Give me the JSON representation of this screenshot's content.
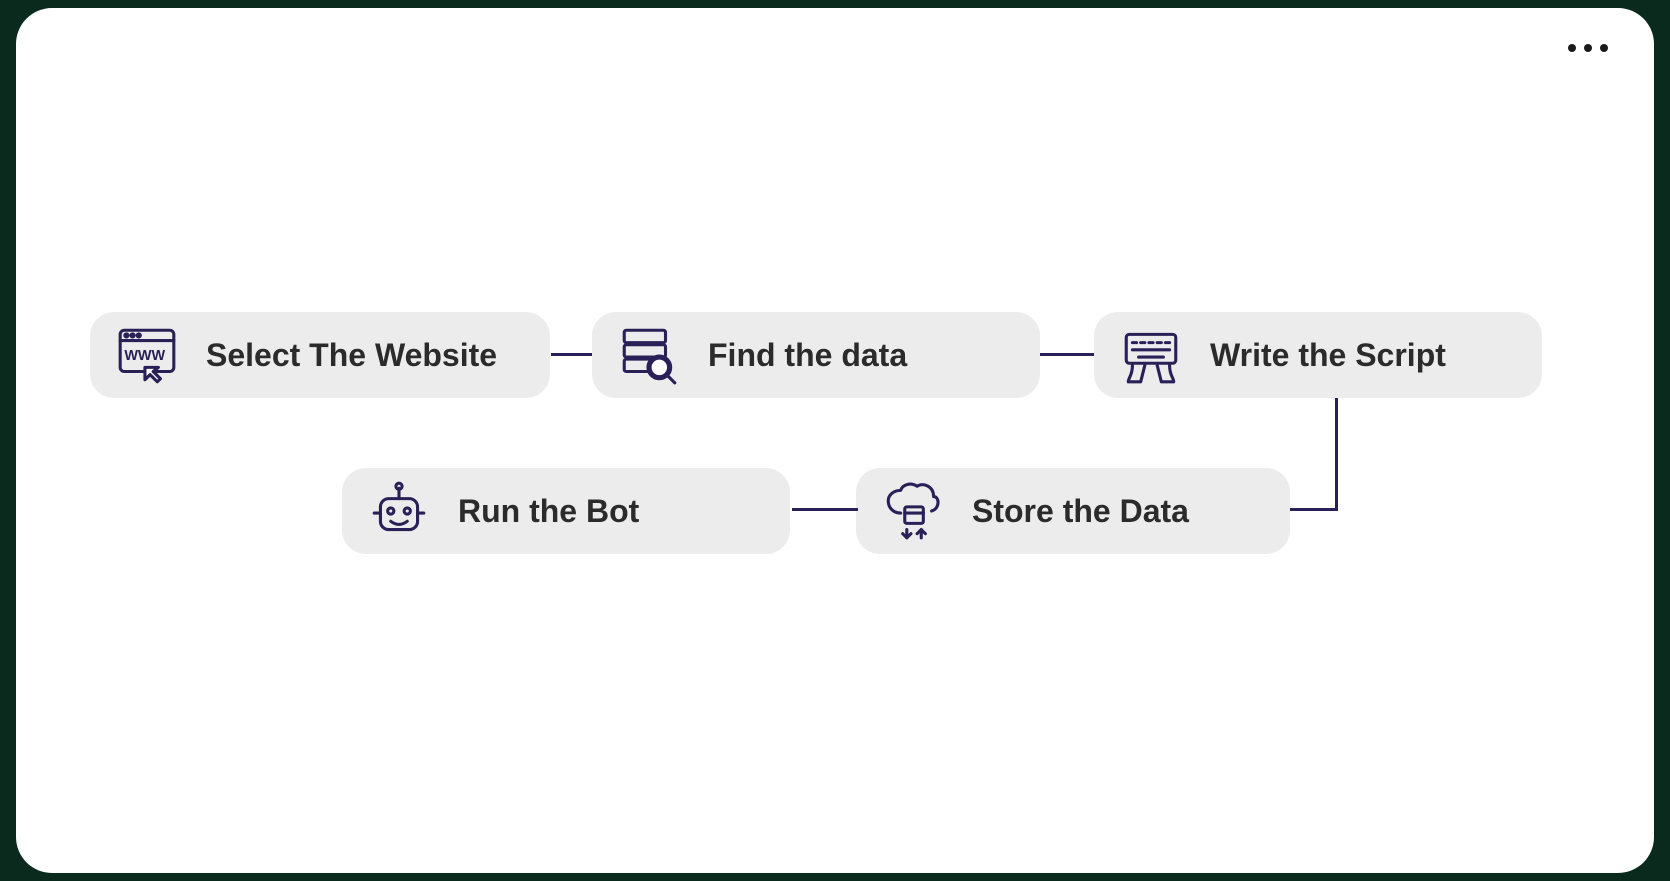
{
  "diagram": {
    "steps": [
      {
        "id": "select-website",
        "label": "Select The Website",
        "icon": "browser-www-icon"
      },
      {
        "id": "find-data",
        "label": "Find the data",
        "icon": "database-search-icon"
      },
      {
        "id": "write-script",
        "label": "Write the Script",
        "icon": "keyboard-hands-icon"
      },
      {
        "id": "store-data",
        "label": "Store the Data",
        "icon": "cloud-sync-icon"
      },
      {
        "id": "run-bot",
        "label": "Run the Bot",
        "icon": "robot-icon"
      }
    ],
    "colors": {
      "iconStroke": "#2a2058",
      "nodeBg": "#ececec",
      "text": "#2b2b2b"
    }
  }
}
